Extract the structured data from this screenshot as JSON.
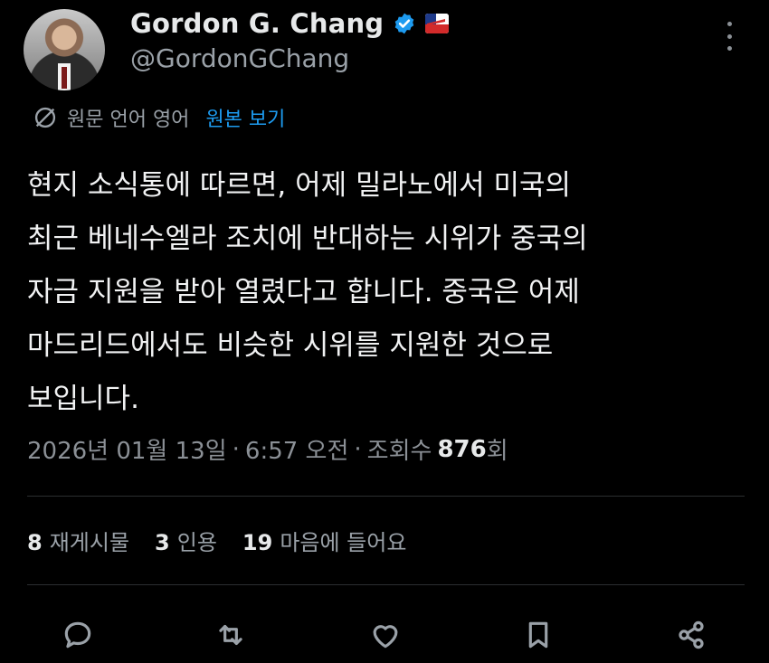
{
  "author": {
    "display_name": "Gordon G. Chang",
    "handle": "@GordonGChang"
  },
  "translation": {
    "label": "원문 언어 영어",
    "show_original": "원본 보기"
  },
  "tweet": {
    "text": "현지 소식통에 따르면, 어제 밀라노에서 미국의\n최근 베네수엘라 조치에 반대하는 시위가 중국의\n자금 지원을 받아 열렸다고 합니다. 중국은 어제\n마드리드에서도 비슷한 시위를 지원한 것으로\n보입니다."
  },
  "meta": {
    "date": "2026년 01월 13일",
    "sep1": "·",
    "time": "6:57 오전",
    "sep2": "·",
    "views_label": "조회수",
    "views_count": "876",
    "views_suffix": "회"
  },
  "stats": {
    "reposts_count": "8",
    "reposts_label": "재게시물",
    "quotes_count": "3",
    "quotes_label": "인용",
    "likes_count": "19",
    "likes_label": "마음에 들어요"
  },
  "colors": {
    "background": "#000000",
    "text": "#e7e9ea",
    "secondary": "#9aa1a8",
    "link": "#1d9bf0",
    "divider": "#2b2e31"
  },
  "icons": [
    "verified-badge-icon",
    "affiliation-flag-icon",
    "more-options-icon",
    "translate-icon",
    "reply-icon",
    "repost-icon",
    "like-icon",
    "bookmark-icon",
    "share-icon"
  ]
}
